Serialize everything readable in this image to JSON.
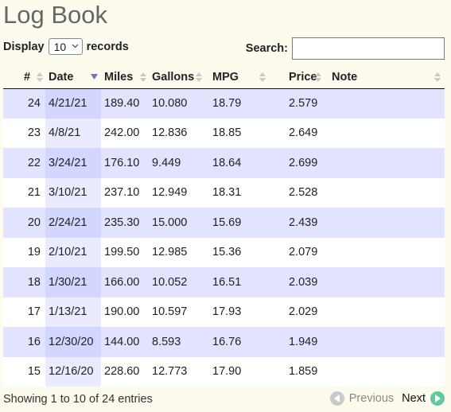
{
  "page": {
    "title": "Log Book"
  },
  "length_menu": {
    "prefix": "Display",
    "selected": "10",
    "suffix": "records"
  },
  "search": {
    "label": "Search:",
    "value": ""
  },
  "table": {
    "columns": [
      "#",
      "Date",
      "Miles",
      "Gallons",
      "MPG",
      "Price",
      "Note"
    ],
    "sort": {
      "column": "Date",
      "direction": "desc"
    },
    "rows": [
      [
        "24",
        "4/21/21",
        "189.40",
        "10.080",
        "18.79",
        "2.579",
        ""
      ],
      [
        "23",
        "4/8/21",
        "242.00",
        "12.836",
        "18.85",
        "2.649",
        ""
      ],
      [
        "22",
        "3/24/21",
        "176.10",
        "9.449",
        "18.64",
        "2.699",
        ""
      ],
      [
        "21",
        "3/10/21",
        "237.10",
        "12.949",
        "18.31",
        "2.528",
        ""
      ],
      [
        "20",
        "2/24/21",
        "235.30",
        "15.000",
        "15.69",
        "2.439",
        ""
      ],
      [
        "19",
        "2/10/21",
        "199.50",
        "12.985",
        "15.36",
        "2.079",
        ""
      ],
      [
        "18",
        "1/30/21",
        "166.00",
        "10.052",
        "16.51",
        "2.039",
        ""
      ],
      [
        "17",
        "1/13/21",
        "190.00",
        "10.597",
        "17.93",
        "2.029",
        ""
      ],
      [
        "16",
        "12/30/20",
        "144.00",
        "8.593",
        "16.76",
        "1.949",
        ""
      ],
      [
        "15",
        "12/16/20",
        "228.60",
        "12.773",
        "17.90",
        "1.859",
        ""
      ]
    ]
  },
  "info": "Showing 1 to 10 of 24 entries",
  "pagination": {
    "previous": "Previous",
    "next": "Next"
  },
  "colors": {
    "background": "#fdfbee",
    "row_odd": "#e2e4ff",
    "row_even": "#ffffff",
    "sorted_col_odd": "#d3d6ff",
    "sorted_col_even": "#eaebff",
    "next_accent": "#5fc9a3"
  }
}
